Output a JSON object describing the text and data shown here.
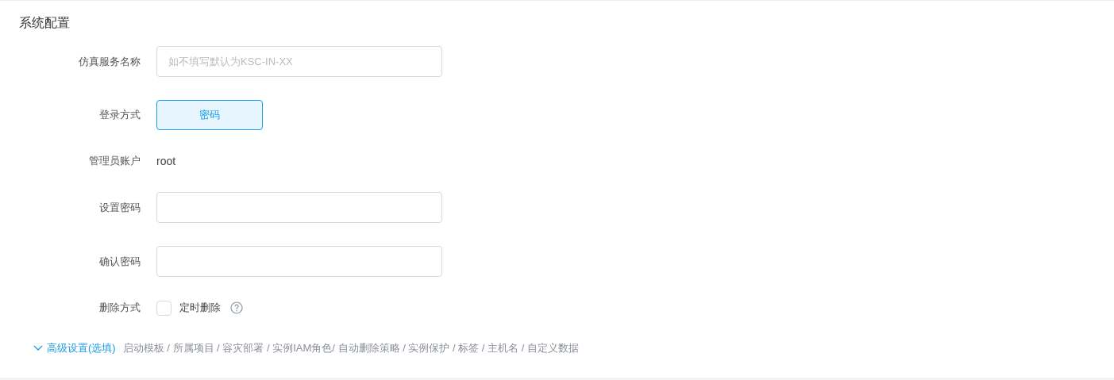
{
  "section_title": "系统配置",
  "fields": [
    {
      "kind": "input",
      "label": "仿真服务名称",
      "placeholder": "如不填写默认为KSC-IN-XX"
    },
    {
      "kind": "options",
      "label": "登录方式",
      "options": [
        {
          "label": "密码",
          "selected": true
        }
      ]
    },
    {
      "kind": "text",
      "label": "管理员账户",
      "value": "root"
    },
    {
      "kind": "input",
      "label": "设置密码"
    },
    {
      "kind": "input",
      "label": "确认密码"
    },
    {
      "kind": "checkbox",
      "label": "删除方式",
      "option": "定时删除",
      "checked": false,
      "help": true
    }
  ],
  "advanced": {
    "label": "高级设置(选填)",
    "expanded": false,
    "summary": "启动模板 / 所属项目 / 容灾部署 / 实例IAM角色/ 自动删除策略 / 实例保护 / 标签 / 主机名 / 自定义数据"
  }
}
